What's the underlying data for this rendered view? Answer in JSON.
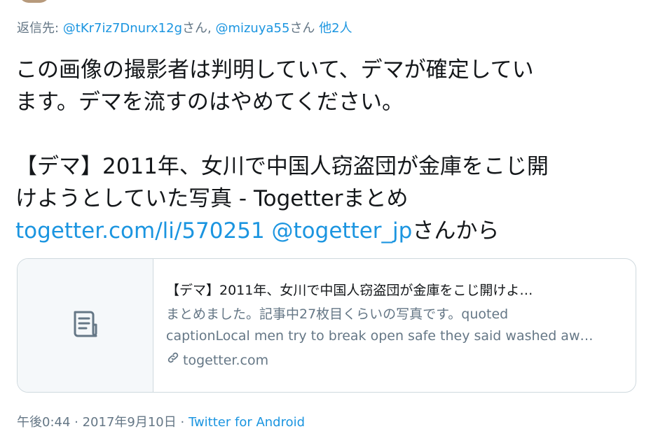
{
  "reply": {
    "prefix": "返信先: ",
    "user1": "@tKr7iz7Dnurx12g",
    "suffix1": "さん, ",
    "user2": "@mizuya55",
    "suffix2": "さん ",
    "others": "他2人"
  },
  "tweet": {
    "line1": "この画像の撮影者は判明していて、デマが確定してい",
    "line2": "ます。デマを流すのはやめてください。",
    "line3": "【デマ】2011年、女川で中国人窃盗団が金庫をこじ開",
    "line4": "けようとしていた写真 - Togetterまとめ",
    "link_url": "togetter.com/li/570251",
    "link_space": " ",
    "link_mention": "@togetter_jp",
    "link_tail": "さんから"
  },
  "card": {
    "icon": "document-icon",
    "title": "【デマ】2011年、女川で中国人窃盗団が金庫をこじ開けよ…",
    "desc_line1": "まとめました。記事中27枚目くらいの写真です。quoted",
    "desc_line2": "captionLocal men try to break open safe they said washed aw…",
    "domain": "togetter.com"
  },
  "meta": {
    "time": "午後0:44",
    "sep1": " · ",
    "date": "2017年9月10日",
    "sep2": " · ",
    "source": "Twitter for Android"
  },
  "colors": {
    "link": "#1b95e0",
    "secondary_text": "#657786",
    "border": "#cfd9de"
  }
}
